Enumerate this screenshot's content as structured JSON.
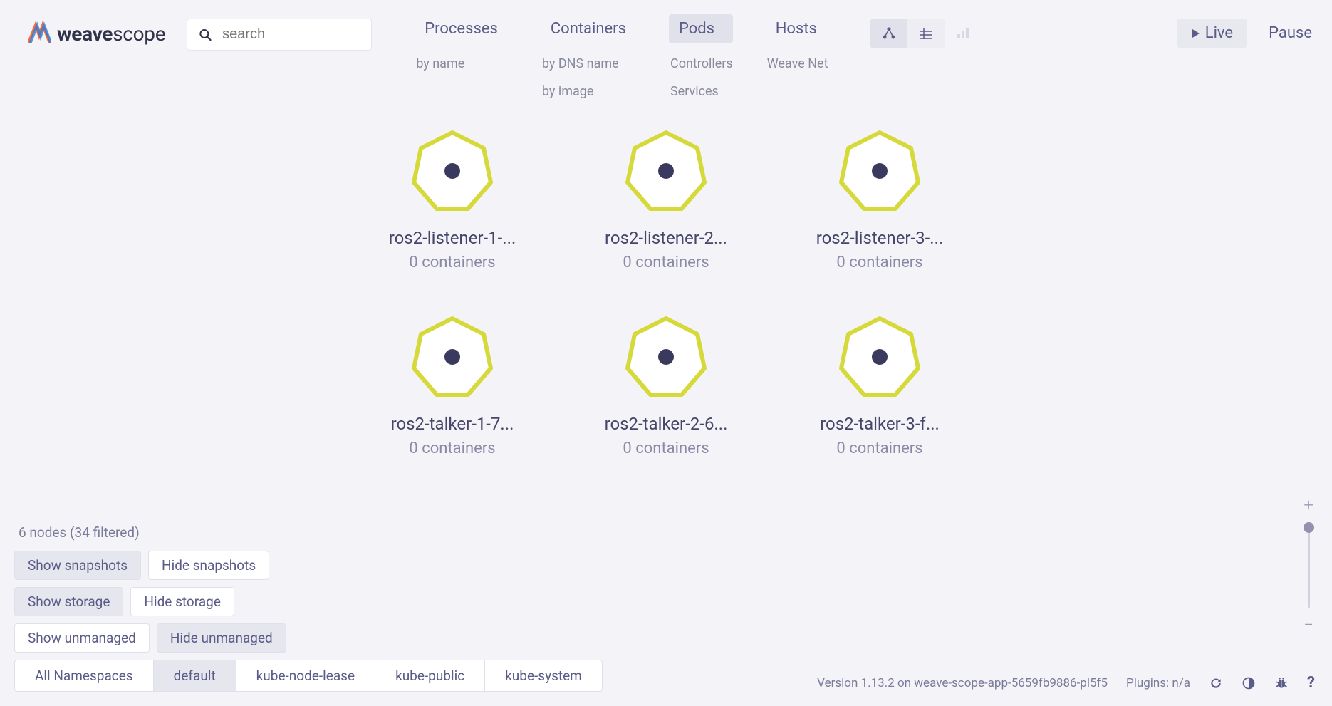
{
  "logo": {
    "bold": "weave",
    "light": "scope"
  },
  "search": {
    "placeholder": "search"
  },
  "nav": [
    {
      "main": "Processes",
      "subs": [
        "by name"
      ]
    },
    {
      "main": "Containers",
      "subs": [
        "by DNS name",
        "by image"
      ]
    },
    {
      "main": "Pods",
      "subs": [
        "Controllers",
        "Services"
      ],
      "active": true
    },
    {
      "main": "Hosts",
      "subs": [
        "Weave Net"
      ]
    }
  ],
  "live": "Live",
  "pause": "Pause",
  "nodes": {
    "row1": [
      {
        "label": "ros2-listener-1-...",
        "sub": "0 containers"
      },
      {
        "label": "ros2-listener-2...",
        "sub": "0 containers"
      },
      {
        "label": "ros2-listener-3-...",
        "sub": "0 containers"
      }
    ],
    "row2": [
      {
        "label": "ros2-talker-1-7...",
        "sub": "0 containers"
      },
      {
        "label": "ros2-talker-2-6...",
        "sub": "0 containers"
      },
      {
        "label": "ros2-talker-3-f...",
        "sub": "0 containers"
      }
    ]
  },
  "filter_info": "6 nodes (34 filtered)",
  "filters": {
    "snapshots": {
      "show": "Show snapshots",
      "hide": "Hide snapshots",
      "active": "show"
    },
    "storage": {
      "show": "Show storage",
      "hide": "Hide storage",
      "active": "show"
    },
    "unmanaged": {
      "show": "Show unmanaged",
      "hide": "Hide unmanaged",
      "active": "hide"
    }
  },
  "namespaces": [
    "All Namespaces",
    "default",
    "kube-node-lease",
    "kube-public",
    "kube-system"
  ],
  "namespace_active": "default",
  "footer": {
    "version": "Version 1.13.2 on weave-scope-app-5659fb9886-pl5f5",
    "plugins": "Plugins: n/a"
  }
}
